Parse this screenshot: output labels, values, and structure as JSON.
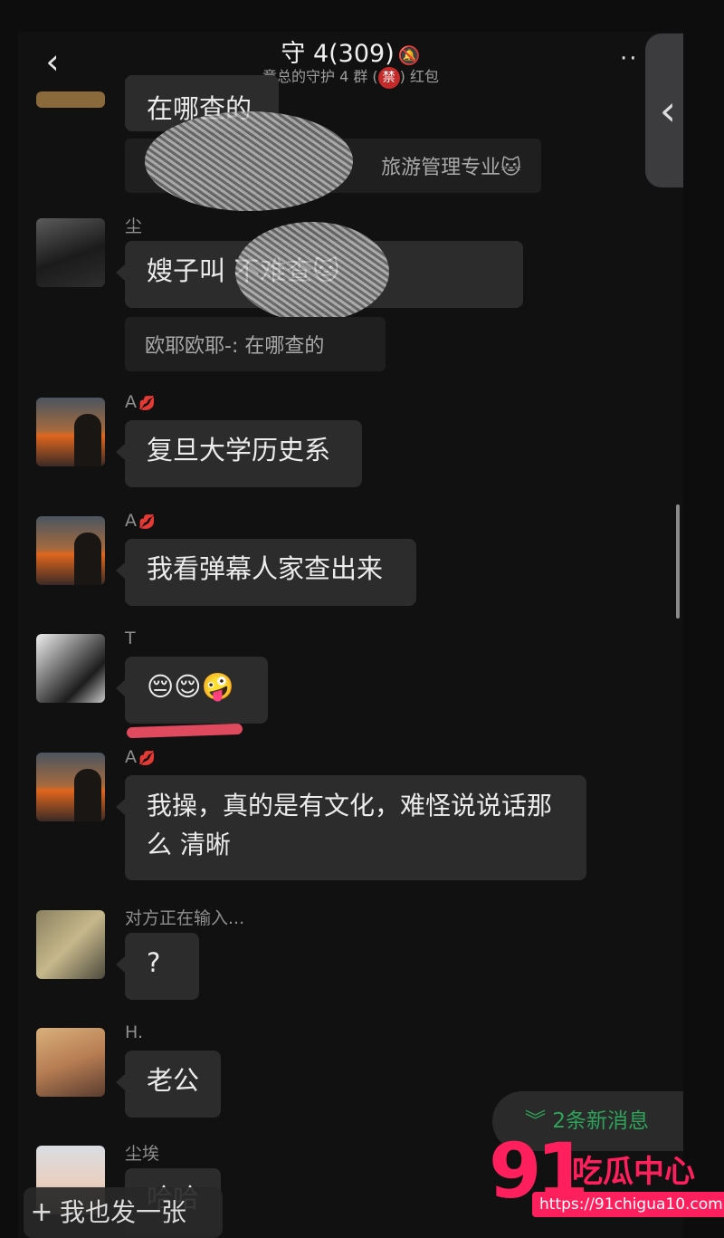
{
  "header": {
    "back_glyph": "‹",
    "title": "守 4(309)",
    "subtitle_pre": "童总的守护 4 群 (",
    "ban_badge": "禁",
    "subtitle_post": ") 红包",
    "more_glyph": "··",
    "side_handle_glyph": "‹"
  },
  "messages": [
    {
      "kind": "partial",
      "text": "在哪查的"
    },
    {
      "kind": "quote",
      "text": "旅游管理专业🐱"
    },
    {
      "sender": "尘",
      "text": "嫂子叫               不难查🐱",
      "quote": "欧耶欧耶-: 在哪查的"
    },
    {
      "sender": "A",
      "text": "复旦大学历史系"
    },
    {
      "sender": "A",
      "text": "我看弹幕人家查出来"
    },
    {
      "sender": "T",
      "text": "😔😌🤪"
    },
    {
      "sender": "A",
      "text": "我操，真的是有文化，难怪说说话那么 清晰"
    },
    {
      "sender": "对方正在输入...",
      "text": "?"
    },
    {
      "sender": "H.",
      "text": "老公"
    },
    {
      "sender": "尘埃",
      "text": "哈哈"
    }
  ],
  "new_messages": {
    "icon": "double-chevron-down-icon",
    "label": "2条新消息"
  },
  "post_bar": {
    "plus": "+",
    "label": "我也发一张"
  },
  "watermark": {
    "number": "91",
    "brand": "吃瓜中心",
    "url": "https://91chigua10.com"
  },
  "colors": {
    "background": "#111111",
    "bubble": "#2c2c2c",
    "accent_green": "#2fa35a",
    "brand_pink": "#ff1f5c"
  }
}
